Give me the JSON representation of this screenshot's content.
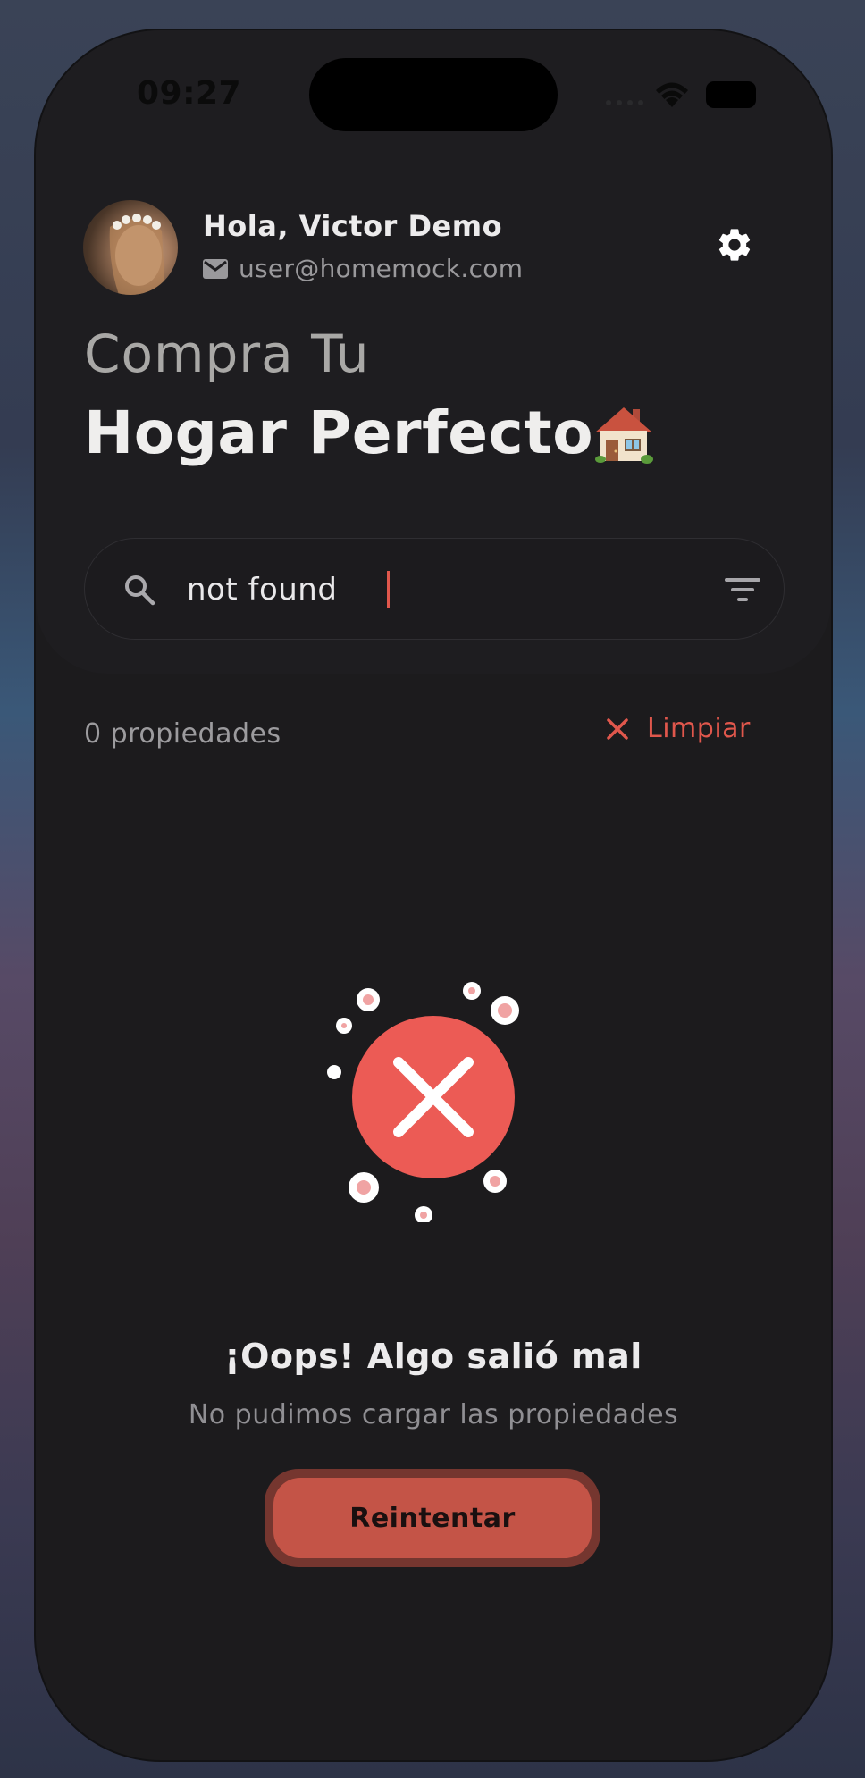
{
  "status_bar": {
    "time": "09:27",
    "icons": [
      "signal-icon",
      "wifi-icon",
      "battery-icon"
    ]
  },
  "header": {
    "greeting": "Hola, Victor Demo",
    "email": "user@homemock.com",
    "title_light": "Compra Tu",
    "title_bold": "Hogar Perfecto",
    "icons": [
      "avatar",
      "mail-icon",
      "gear-icon",
      "house-icon"
    ]
  },
  "search": {
    "value": "not found",
    "icons": [
      "search-icon",
      "filter-icon"
    ]
  },
  "results": {
    "count": "0 propiedades",
    "clear_label": "Limpiar"
  },
  "error": {
    "title": "¡Oops! Algo salió mal",
    "subtitle": "No pudimos cargar las propiedades",
    "retry_label": "Reintentar"
  },
  "colors": {
    "accent": "#e0574c",
    "error_circle": "#ec5b55",
    "background": "#1c1b1d"
  }
}
